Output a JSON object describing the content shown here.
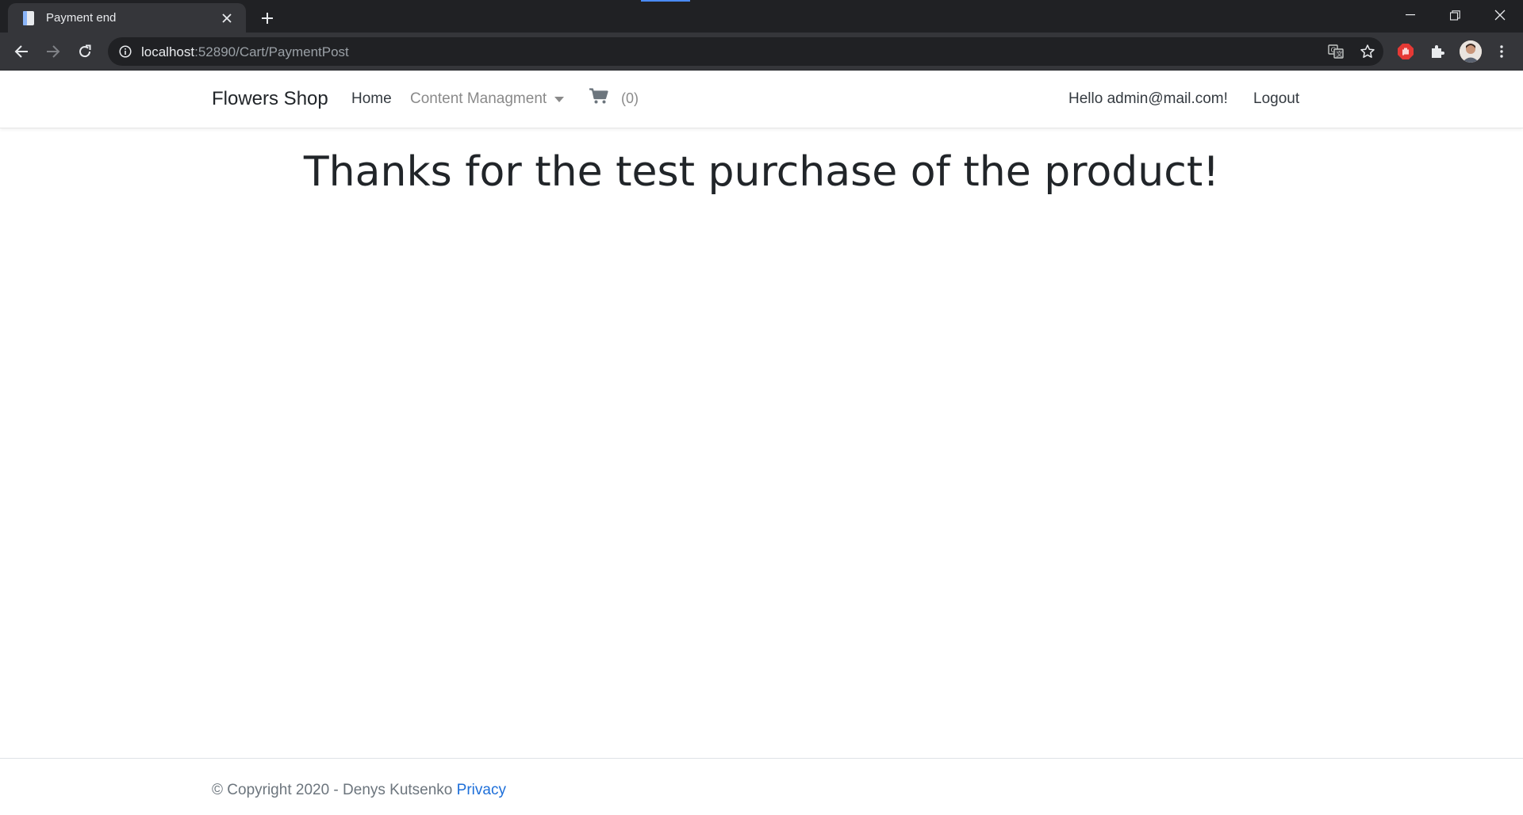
{
  "browser": {
    "tab_title": "Payment end",
    "url_host": "localhost",
    "url_path": ":52890/Cart/PaymentPost"
  },
  "site": {
    "brand": "Flowers Shop",
    "nav": {
      "home": "Home",
      "content_management": "Content Managment",
      "cart_count": "(0)",
      "greeting": "Hello admin@mail.com!",
      "logout": "Logout"
    },
    "heading": "Thanks for the test purchase of the product!",
    "footer": {
      "copyright": "© Copyright 2020 - Denys Kutsenko",
      "privacy": "Privacy"
    }
  },
  "colors": {
    "chrome_dark": "#202124",
    "chrome_toolbar": "#35363a",
    "link_blue": "#1e6fd9",
    "text_dark": "#212529",
    "text_muted": "#8a8a8a"
  }
}
